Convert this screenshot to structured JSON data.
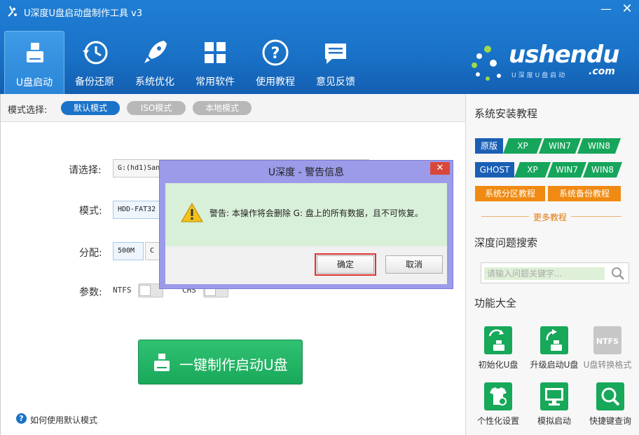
{
  "window": {
    "title": "U深度U盘启动盘制作工具 v3",
    "minimize": "—",
    "close": "✕"
  },
  "nav": [
    {
      "label": "U盘启动",
      "icon": "usb-drive-icon",
      "active": true
    },
    {
      "label": "备份还原",
      "icon": "clock-restore-icon",
      "active": false
    },
    {
      "label": "系统优化",
      "icon": "rocket-icon",
      "active": false
    },
    {
      "label": "常用软件",
      "icon": "grid-apps-icon",
      "active": false
    },
    {
      "label": "使用教程",
      "icon": "question-icon",
      "active": false
    },
    {
      "label": "意见反馈",
      "icon": "chat-bubble-icon",
      "active": false
    }
  ],
  "brand": {
    "text": "ushendu",
    "domain": ".com",
    "slogan": "U深度U盘启动"
  },
  "mode": {
    "label": "模式选择:",
    "options": [
      "默认模式",
      "ISO模式",
      "本地模式"
    ],
    "selected": "默认模式"
  },
  "form": {
    "select_label": "请选择:",
    "select_value": "G:(hd1)San",
    "mode_label": "模式:",
    "mode_value": "HDD-FAT32",
    "partition_label": "分配:",
    "partition_value": "500M",
    "partition_value2": "C",
    "params_label": "参数:",
    "param1": "NTFS",
    "param2": "CHS"
  },
  "main_button": "一键制作启动U盘",
  "help_link": "如何使用默认模式",
  "right": {
    "install_title": "系统安装教程",
    "rows": [
      {
        "lead": "原版",
        "items": [
          "XP",
          "WIN7",
          "WIN8"
        ]
      },
      {
        "lead": "GHOST",
        "items": [
          "XP",
          "WIN7",
          "WIN8"
        ]
      }
    ],
    "orange": [
      "系统分区教程",
      "系统备份教程"
    ],
    "more": "更多教程",
    "search_title": "深度问题搜索",
    "search_placeholder": "请输入问题关键字...",
    "tools_title": "功能大全",
    "tools": [
      {
        "label": "初始化U盘",
        "enabled": true
      },
      {
        "label": "升级启动U盘",
        "enabled": true
      },
      {
        "label": "U盘转换格式",
        "enabled": false,
        "badge": "NTFS"
      },
      {
        "label": "个性化设置",
        "enabled": true
      },
      {
        "label": "模拟启动",
        "enabled": true
      },
      {
        "label": "快捷键查询",
        "enabled": true
      }
    ]
  },
  "dialog": {
    "title": "U深度 - 警告信息",
    "message": "警告: 本操作将会删除 G: 盘上的所有数据，且不可恢复。",
    "ok": "确定",
    "cancel": "取消",
    "close": "✕"
  },
  "colors": {
    "primary": "#1a73c8",
    "green": "#16a55a",
    "orange": "#f08a12",
    "dialog_frame": "#9b9be9",
    "dialog_body": "#d8efd8"
  }
}
